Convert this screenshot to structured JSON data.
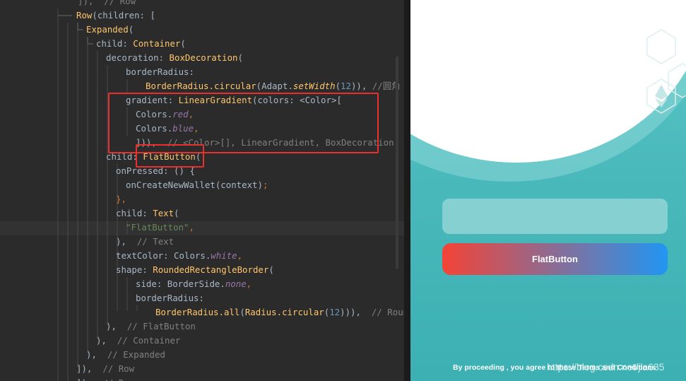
{
  "editor": {
    "lines": [
      [
        {
          "t": "]),  // Row",
          "c": "cm"
        }
      ],
      [
        {
          "t": "Row",
          "c": "fn"
        },
        {
          "t": "(children: [",
          "c": "plain"
        }
      ],
      [
        {
          "t": "Expanded",
          "c": "fn"
        },
        {
          "t": "(",
          "c": "plain"
        }
      ],
      [
        {
          "t": "child",
          "c": "plain"
        },
        {
          "t": ": ",
          "c": "plain"
        },
        {
          "t": "Container",
          "c": "fn"
        },
        {
          "t": "(",
          "c": "plain"
        }
      ],
      [
        {
          "t": "decoration",
          "c": "plain"
        },
        {
          "t": ": ",
          "c": "plain"
        },
        {
          "t": "BoxDecoration",
          "c": "fn"
        },
        {
          "t": "(",
          "c": "plain"
        }
      ],
      [
        {
          "t": "borderRadius:",
          "c": "plain"
        }
      ],
      [
        {
          "t": "BorderRadius.",
          "c": "fn"
        },
        {
          "t": "circular",
          "c": "fn"
        },
        {
          "t": "(Adapt.",
          "c": "plain"
        },
        {
          "t": "setWidth",
          "c": "fnit"
        },
        {
          "t": "(",
          "c": "plain"
        },
        {
          "t": "12",
          "c": "num"
        },
        {
          "t": ")), ",
          "c": "plain"
        },
        {
          "t": "//圆角",
          "c": "cm"
        }
      ],
      [
        {
          "t": "gradient",
          "c": "plain"
        },
        {
          "t": ": ",
          "c": "plain"
        },
        {
          "t": "LinearGradient",
          "c": "fn"
        },
        {
          "t": "(colors: <Color>[",
          "c": "plain"
        }
      ],
      [
        {
          "t": "Colors.",
          "c": "plain"
        },
        {
          "t": "red",
          "c": "it"
        },
        {
          "t": ",",
          "c": "kw"
        }
      ],
      [
        {
          "t": "Colors.",
          "c": "plain"
        },
        {
          "t": "blue",
          "c": "it"
        },
        {
          "t": ",",
          "c": "kw"
        }
      ],
      [
        {
          "t": "])),  ",
          "c": "plain"
        },
        {
          "t": "// <Color>[], LinearGradient, BoxDecoration",
          "c": "cm"
        }
      ],
      [
        {
          "t": "child",
          "c": "plain"
        },
        {
          "t": ": ",
          "c": "plain"
        },
        {
          "t": "FlatButton",
          "c": "fn"
        },
        {
          "t": "(",
          "c": "plain"
        }
      ],
      [
        {
          "t": "onPressed",
          "c": "plain"
        },
        {
          "t": ": () {",
          "c": "plain"
        }
      ],
      [
        {
          "t": "onCreateNewWallet(context)",
          "c": "plain"
        },
        {
          "t": ";",
          "c": "kw"
        }
      ],
      [
        {
          "t": "},",
          "c": "kw"
        }
      ],
      [
        {
          "t": "child",
          "c": "plain"
        },
        {
          "t": ": ",
          "c": "plain"
        },
        {
          "t": "Text",
          "c": "fn"
        },
        {
          "t": "(",
          "c": "plain"
        }
      ],
      [
        {
          "t": "\"FlatButton\"",
          "c": "str"
        },
        {
          "t": ",",
          "c": "kw"
        }
      ],
      [
        {
          "t": "),  ",
          "c": "plain"
        },
        {
          "t": "// Text",
          "c": "cm"
        }
      ],
      [
        {
          "t": "textColor",
          "c": "plain"
        },
        {
          "t": ": Colors.",
          "c": "plain"
        },
        {
          "t": "white",
          "c": "it"
        },
        {
          "t": ",",
          "c": "kw"
        }
      ],
      [
        {
          "t": "shape",
          "c": "plain"
        },
        {
          "t": ": ",
          "c": "plain"
        },
        {
          "t": "RoundedRectangleBorder",
          "c": "fn"
        },
        {
          "t": "(",
          "c": "plain"
        }
      ],
      [
        {
          "t": "side",
          "c": "plain"
        },
        {
          "t": ": BorderSide.",
          "c": "plain"
        },
        {
          "t": "none",
          "c": "it"
        },
        {
          "t": ",",
          "c": "kw"
        }
      ],
      [
        {
          "t": "borderRadius:",
          "c": "plain"
        }
      ],
      [
        {
          "t": "BorderRadius.",
          "c": "fn"
        },
        {
          "t": "all",
          "c": "fn"
        },
        {
          "t": "(",
          "c": "plain"
        },
        {
          "t": "Radius.",
          "c": "fn"
        },
        {
          "t": "circular",
          "c": "fn"
        },
        {
          "t": "(",
          "c": "plain"
        },
        {
          "t": "12",
          "c": "num"
        },
        {
          "t": "))),  ",
          "c": "plain"
        },
        {
          "t": "// Round",
          "c": "cm"
        }
      ],
      [
        {
          "t": "),  ",
          "c": "plain"
        },
        {
          "t": "// FlatButton",
          "c": "cm"
        }
      ],
      [
        {
          "t": "),  ",
          "c": "plain"
        },
        {
          "t": "// Container",
          "c": "cm"
        }
      ],
      [
        {
          "t": "),  ",
          "c": "plain"
        },
        {
          "t": "// Expanded",
          "c": "cm"
        }
      ],
      [
        {
          "t": "]),  ",
          "c": "plain"
        },
        {
          "t": "// Row",
          "c": "cm"
        }
      ],
      [
        {
          "t": "]),  ",
          "c": "plain"
        },
        {
          "t": "// Row",
          "c": "cm"
        }
      ]
    ]
  },
  "phone": {
    "button_label": "FlatButton",
    "terms_prefix": "By proceeding , you agree to these ",
    "terms_link": "Terms and Conditions",
    "colors": {
      "gradient_start": "#f44336",
      "gradient_end": "#2196f3",
      "background": "#4ab9bb"
    }
  },
  "watermark": "https://blog.csdn.net/jia635"
}
